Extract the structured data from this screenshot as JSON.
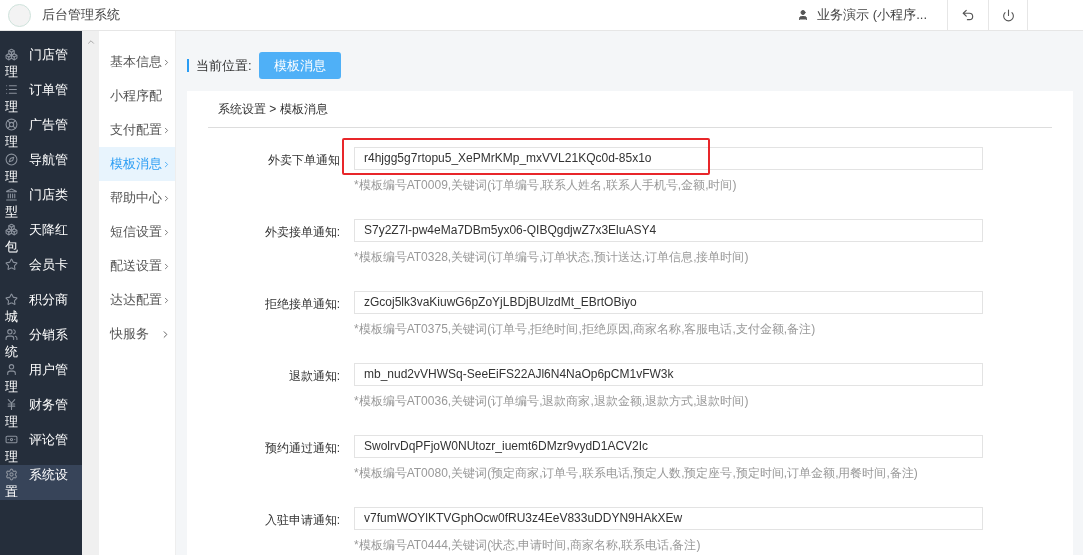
{
  "header": {
    "title": "后台管理系统",
    "user": "业务演示 (小程序..."
  },
  "sidebar": {
    "items": [
      {
        "label": "门店管理",
        "selected": false
      },
      {
        "label": "订单管理",
        "selected": false
      },
      {
        "label": "广告管理",
        "selected": false
      },
      {
        "label": "导航管理",
        "selected": false
      },
      {
        "label": "门店类型",
        "selected": false
      },
      {
        "label": "天降红包",
        "selected": false
      },
      {
        "label": "会员卡",
        "selected": false
      },
      {
        "label": "积分商城",
        "selected": false
      },
      {
        "label": "分销系统",
        "selected": false
      },
      {
        "label": "用户管理",
        "selected": false
      },
      {
        "label": "财务管理",
        "selected": false
      },
      {
        "label": "评论管理",
        "selected": false
      },
      {
        "label": "系统设置",
        "selected": true
      }
    ]
  },
  "subnav": {
    "items": [
      {
        "label": "基本信息",
        "chevron": true,
        "selected": false
      },
      {
        "label": "小程序配",
        "chevron": false,
        "selected": false
      },
      {
        "label": "支付配置",
        "chevron": true,
        "selected": false
      },
      {
        "label": "模板消息",
        "chevron": true,
        "selected": true
      },
      {
        "label": "帮助中心",
        "chevron": true,
        "selected": false
      },
      {
        "label": "短信设置",
        "chevron": true,
        "selected": false
      },
      {
        "label": "配送设置",
        "chevron": true,
        "selected": false
      },
      {
        "label": "达达配置",
        "chevron": true,
        "selected": false
      },
      {
        "label": "快服务",
        "chevron": true,
        "selected": false
      }
    ]
  },
  "location": {
    "label": "当前位置:",
    "button": "模板消息"
  },
  "breadcrumb": "系统设置 > 模板消息",
  "form": {
    "rows": [
      {
        "label": "外卖下单通知",
        "value": "r4hjgg5g7rtopu5_XePMrKMp_mxVVL21KQc0d-85x1o",
        "hint": "*模板编号AT0009,关键词(订单编号,联系人姓名,联系人手机号,金额,时间)",
        "highlighted": true
      },
      {
        "label": "外卖接单通知:",
        "value": "S7y2Z7l-pw4eMa7DBm5yx06-QIBQgdjwZ7x3EluASY4",
        "hint": "*模板编号AT0328,关键词(订单编号,订单状态,预计送达,订单信息,接单时间)",
        "highlighted": false
      },
      {
        "label": "拒绝接单通知:",
        "value": "zGcoj5lk3vaKiuwG6pZoYjLBDjBUlzdMt_EBrtOBiyo",
        "hint": "*模板编号AT0375,关键词(订单号,拒绝时间,拒绝原因,商家名称,客服电话,支付金额,备注)",
        "highlighted": false
      },
      {
        "label": "退款通知:",
        "value": "mb_nud2vVHWSq-SeeEiFS22AJl6N4NaOp6pCM1vFW3k",
        "hint": "*模板编号AT0036,关键词(订单编号,退款商家,退款金额,退款方式,退款时间)",
        "highlighted": false
      },
      {
        "label": "预约通过通知:",
        "value": "SwolrvDqPFjoW0NUtozr_iuemt6DMzr9vydD1ACV2Ic",
        "hint": "*模板编号AT0080,关键词(预定商家,订单号,联系电话,预定人数,预定座号,预定时间,订单金额,用餐时间,备注)",
        "highlighted": false
      },
      {
        "label": "入驻申请通知:",
        "value": "v7fumWOYlKTVGphOcw0fRU3z4EeV833uDDYN9HAkXEw",
        "hint": "*模板编号AT0444,关键词(状态,申请时间,商家名称,联系电话,备注)",
        "highlighted": false
      }
    ]
  }
}
